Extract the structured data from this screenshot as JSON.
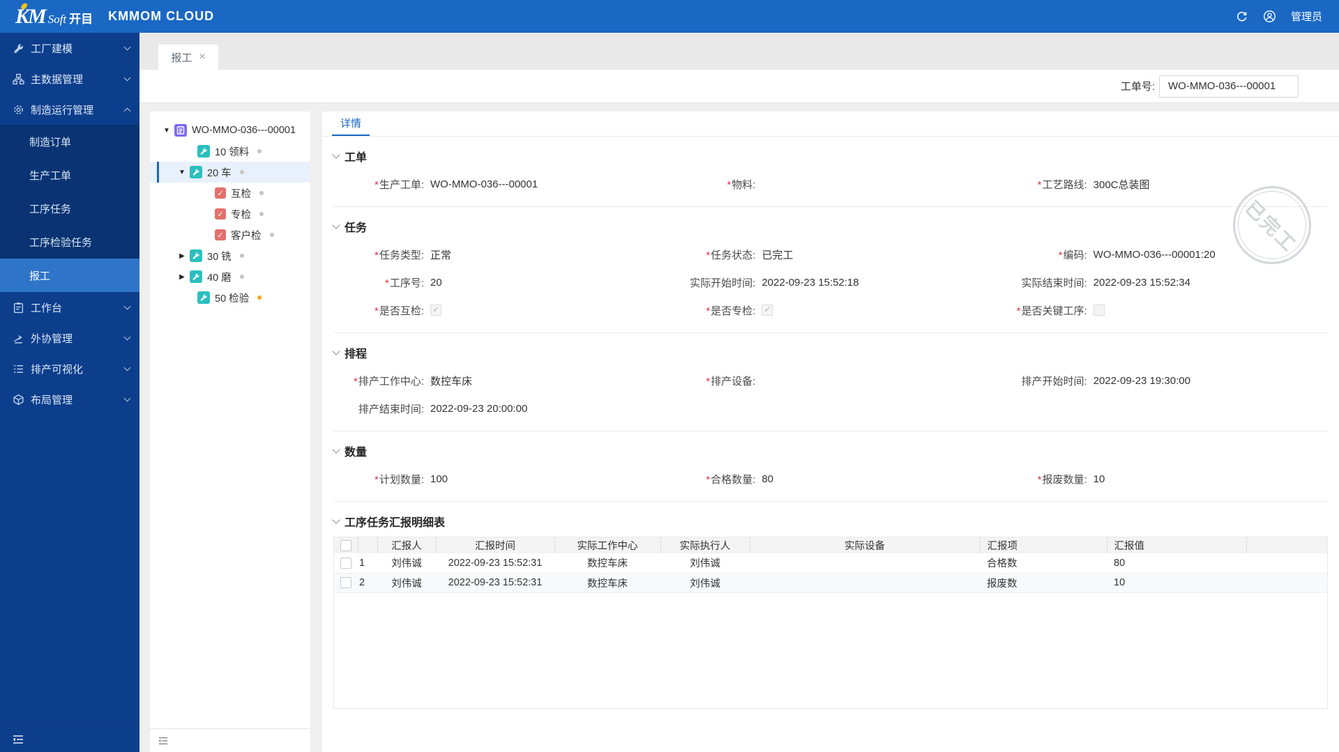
{
  "colors": {
    "accent": "#1766C0",
    "topbar": "#1A68C4",
    "sidebar": "#0C3E8C",
    "required": "#D9363E",
    "teal_icon": "#2BBFBF",
    "purple_icon": "#7C6AF0",
    "salmon_icon": "#E2706C",
    "warn_dot": "#F5A623"
  },
  "header": {
    "logo_km": "KM",
    "logo_soft": "Soft",
    "logo_cn": "开目",
    "product_name": "KMMOM CLOUD",
    "username": "管理员"
  },
  "sidebar": {
    "items": [
      {
        "label": "工厂建模"
      },
      {
        "label": "主数据管理"
      },
      {
        "label": "制造运行管理"
      },
      {
        "label": "制造订单"
      },
      {
        "label": "生产工单"
      },
      {
        "label": "工序任务"
      },
      {
        "label": "工序检验任务"
      },
      {
        "label": "报工"
      },
      {
        "label": "工作台"
      },
      {
        "label": "外协管理"
      },
      {
        "label": "排产可视化"
      },
      {
        "label": "布局管理"
      }
    ]
  },
  "tab_bar": {
    "active_tab": "报工",
    "close": "×"
  },
  "toolbar": {
    "work_order_label": "工单号:",
    "work_order_value": "WO-MMO-036---00001"
  },
  "tree": {
    "root": "WO-MMO-036---00001",
    "n1": "10 领料",
    "n2": "20 车",
    "n3": "互检",
    "n4": "专检",
    "n5": "客户检",
    "n6": "30 铣",
    "n7": "40 磨",
    "n8": "50 检验",
    "check_glyph": "✓"
  },
  "detail": {
    "tab": "详情",
    "stamp": "已完工",
    "sections": {
      "workorder": {
        "title": "工单",
        "f1": {
          "req": true,
          "label": "生产工单:",
          "value": "WO-MMO-036---00001"
        },
        "f2": {
          "req": true,
          "label": "物料:",
          "value": ""
        },
        "f3": {
          "req": true,
          "label": "工艺路线:",
          "value": "300C总装图"
        }
      },
      "task": {
        "title": "任务",
        "f1": {
          "req": true,
          "label": "任务类型:",
          "value": "正常"
        },
        "f2": {
          "req": true,
          "label": "任务状态:",
          "value": "已完工"
        },
        "f3": {
          "req": true,
          "label": "编码:",
          "value": "WO-MMO-036---00001:20"
        },
        "f4": {
          "req": true,
          "label": "工序号:",
          "value": "20"
        },
        "f5": {
          "req": false,
          "label": "实际开始时间:",
          "value": "2022-09-23 15:52:18"
        },
        "f6": {
          "req": false,
          "label": "实际结束时间:",
          "value": "2022-09-23 15:52:34"
        },
        "f7": {
          "req": true,
          "label": "是否互检:",
          "checked": true
        },
        "f8": {
          "req": true,
          "label": "是否专检:",
          "checked": true
        },
        "f9": {
          "req": true,
          "label": "是否关键工序:",
          "checked": false
        }
      },
      "schedule": {
        "title": "排程",
        "f1": {
          "req": true,
          "label": "排产工作中心:",
          "value": "数控车床"
        },
        "f2": {
          "req": true,
          "label": "排产设备:",
          "value": ""
        },
        "f3": {
          "req": false,
          "label": "排产开始时间:",
          "value": "2022-09-23 19:30:00"
        },
        "f4": {
          "req": false,
          "label": "排产结束时间:",
          "value": "2022-09-23 20:00:00"
        }
      },
      "quantity": {
        "title": "数量",
        "f1": {
          "req": true,
          "label": "计划数量:",
          "value": "100"
        },
        "f2": {
          "req": true,
          "label": "合格数量:",
          "value": "80"
        },
        "f3": {
          "req": true,
          "label": "报废数量:",
          "value": "10"
        }
      }
    }
  },
  "report_table": {
    "title": "工序任务汇报明细表",
    "columns": {
      "c1": "汇报人",
      "c2": "汇报时间",
      "c3": "实际工作中心",
      "c4": "实际执行人",
      "c5": "实际设备",
      "c6": "汇报项",
      "c7": "汇报值"
    },
    "rows": [
      {
        "index": "1",
        "reporter": "刘伟诚",
        "time": "2022-09-23 15:52:31",
        "work_center": "数控车床",
        "executor": "刘伟诚",
        "device": "",
        "item": "合格数",
        "value": "80"
      },
      {
        "index": "2",
        "reporter": "刘伟诚",
        "time": "2022-09-23 15:52:31",
        "work_center": "数控车床",
        "executor": "刘伟诚",
        "device": "",
        "item": "报废数",
        "value": "10"
      }
    ]
  }
}
